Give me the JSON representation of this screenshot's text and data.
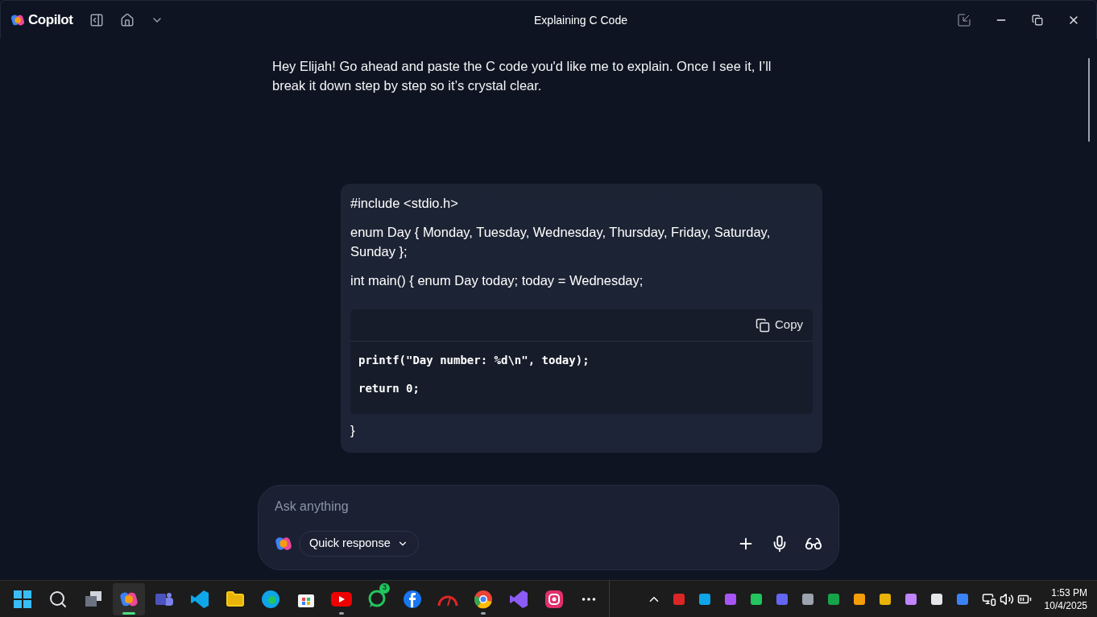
{
  "window": {
    "title": "Explaining C Code",
    "app_name": "Copilot"
  },
  "assistant_message": "Hey Elijah! Go ahead and paste the C code you'd like me to explain. Once I see it, I’ll break it down step by step so it’s crystal clear.",
  "user_message": {
    "lines_before": [
      "#include <stdio.h>",
      "enum Day { Monday, Tuesday, Wednesday, Thursday, Friday, Saturday, Sunday };",
      "int main() { enum Day today; today = Wednesday;"
    ],
    "code_block": {
      "copy_label": "Copy",
      "lines": [
        "printf(\"Day number: %d\\n\", today);",
        "return 0;"
      ]
    },
    "lines_after": [
      "}"
    ]
  },
  "composer": {
    "placeholder": "Ask anything",
    "mode": "Quick response"
  },
  "taskbar": {
    "apps": [
      {
        "selected": false,
        "running": false
      },
      {
        "selected": false,
        "running": false
      },
      {
        "selected": false,
        "running": false
      },
      {
        "selected": true,
        "running": true
      },
      {
        "selected": false,
        "running": false
      },
      {
        "selected": false,
        "running": false
      },
      {
        "selected": false,
        "running": false
      },
      {
        "selected": false,
        "running": false
      },
      {
        "selected": false,
        "running": false
      },
      {
        "selected": false,
        "running": true
      },
      {
        "selected": false,
        "running": false,
        "badge": "3"
      },
      {
        "selected": false,
        "running": false
      },
      {
        "selected": false,
        "running": false
      },
      {
        "selected": false,
        "running": true
      },
      {
        "selected": false,
        "running": false
      },
      {
        "selected": false,
        "running": false
      }
    ],
    "time": "1:53 PM",
    "date": "10/4/2025"
  }
}
